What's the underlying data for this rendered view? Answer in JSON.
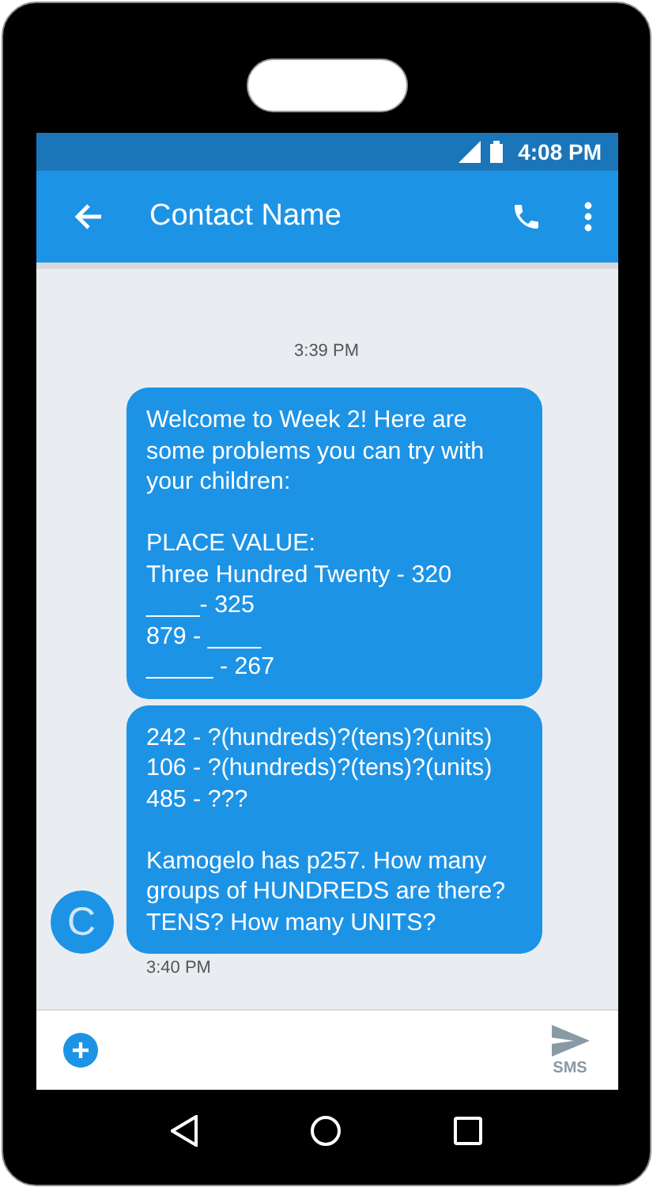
{
  "status_bar": {
    "time": "4:08 PM"
  },
  "app_bar": {
    "title": "Contact Name"
  },
  "conversation": {
    "timestamp": "3:39 PM",
    "messages": [
      {
        "text": "Welcome to Week 2! Here are some problems you can try with your children:\n\nPLACE VALUE:\nThree Hundred Twenty - 320\n____- 325\n879 - ____\n_____ - 267"
      },
      {
        "text": "242 - ?(hundreds)?(tens)?(units)\n106 - ?(hundreds)?(tens)?(units)\n485 - ???\n\nKamogelo has p257. How many groups of HUNDREDS are there? TENS? How many UNITS?"
      }
    ],
    "avatar": "C",
    "sent_time": "3:40 PM"
  },
  "composer": {
    "send_label": "SMS"
  }
}
